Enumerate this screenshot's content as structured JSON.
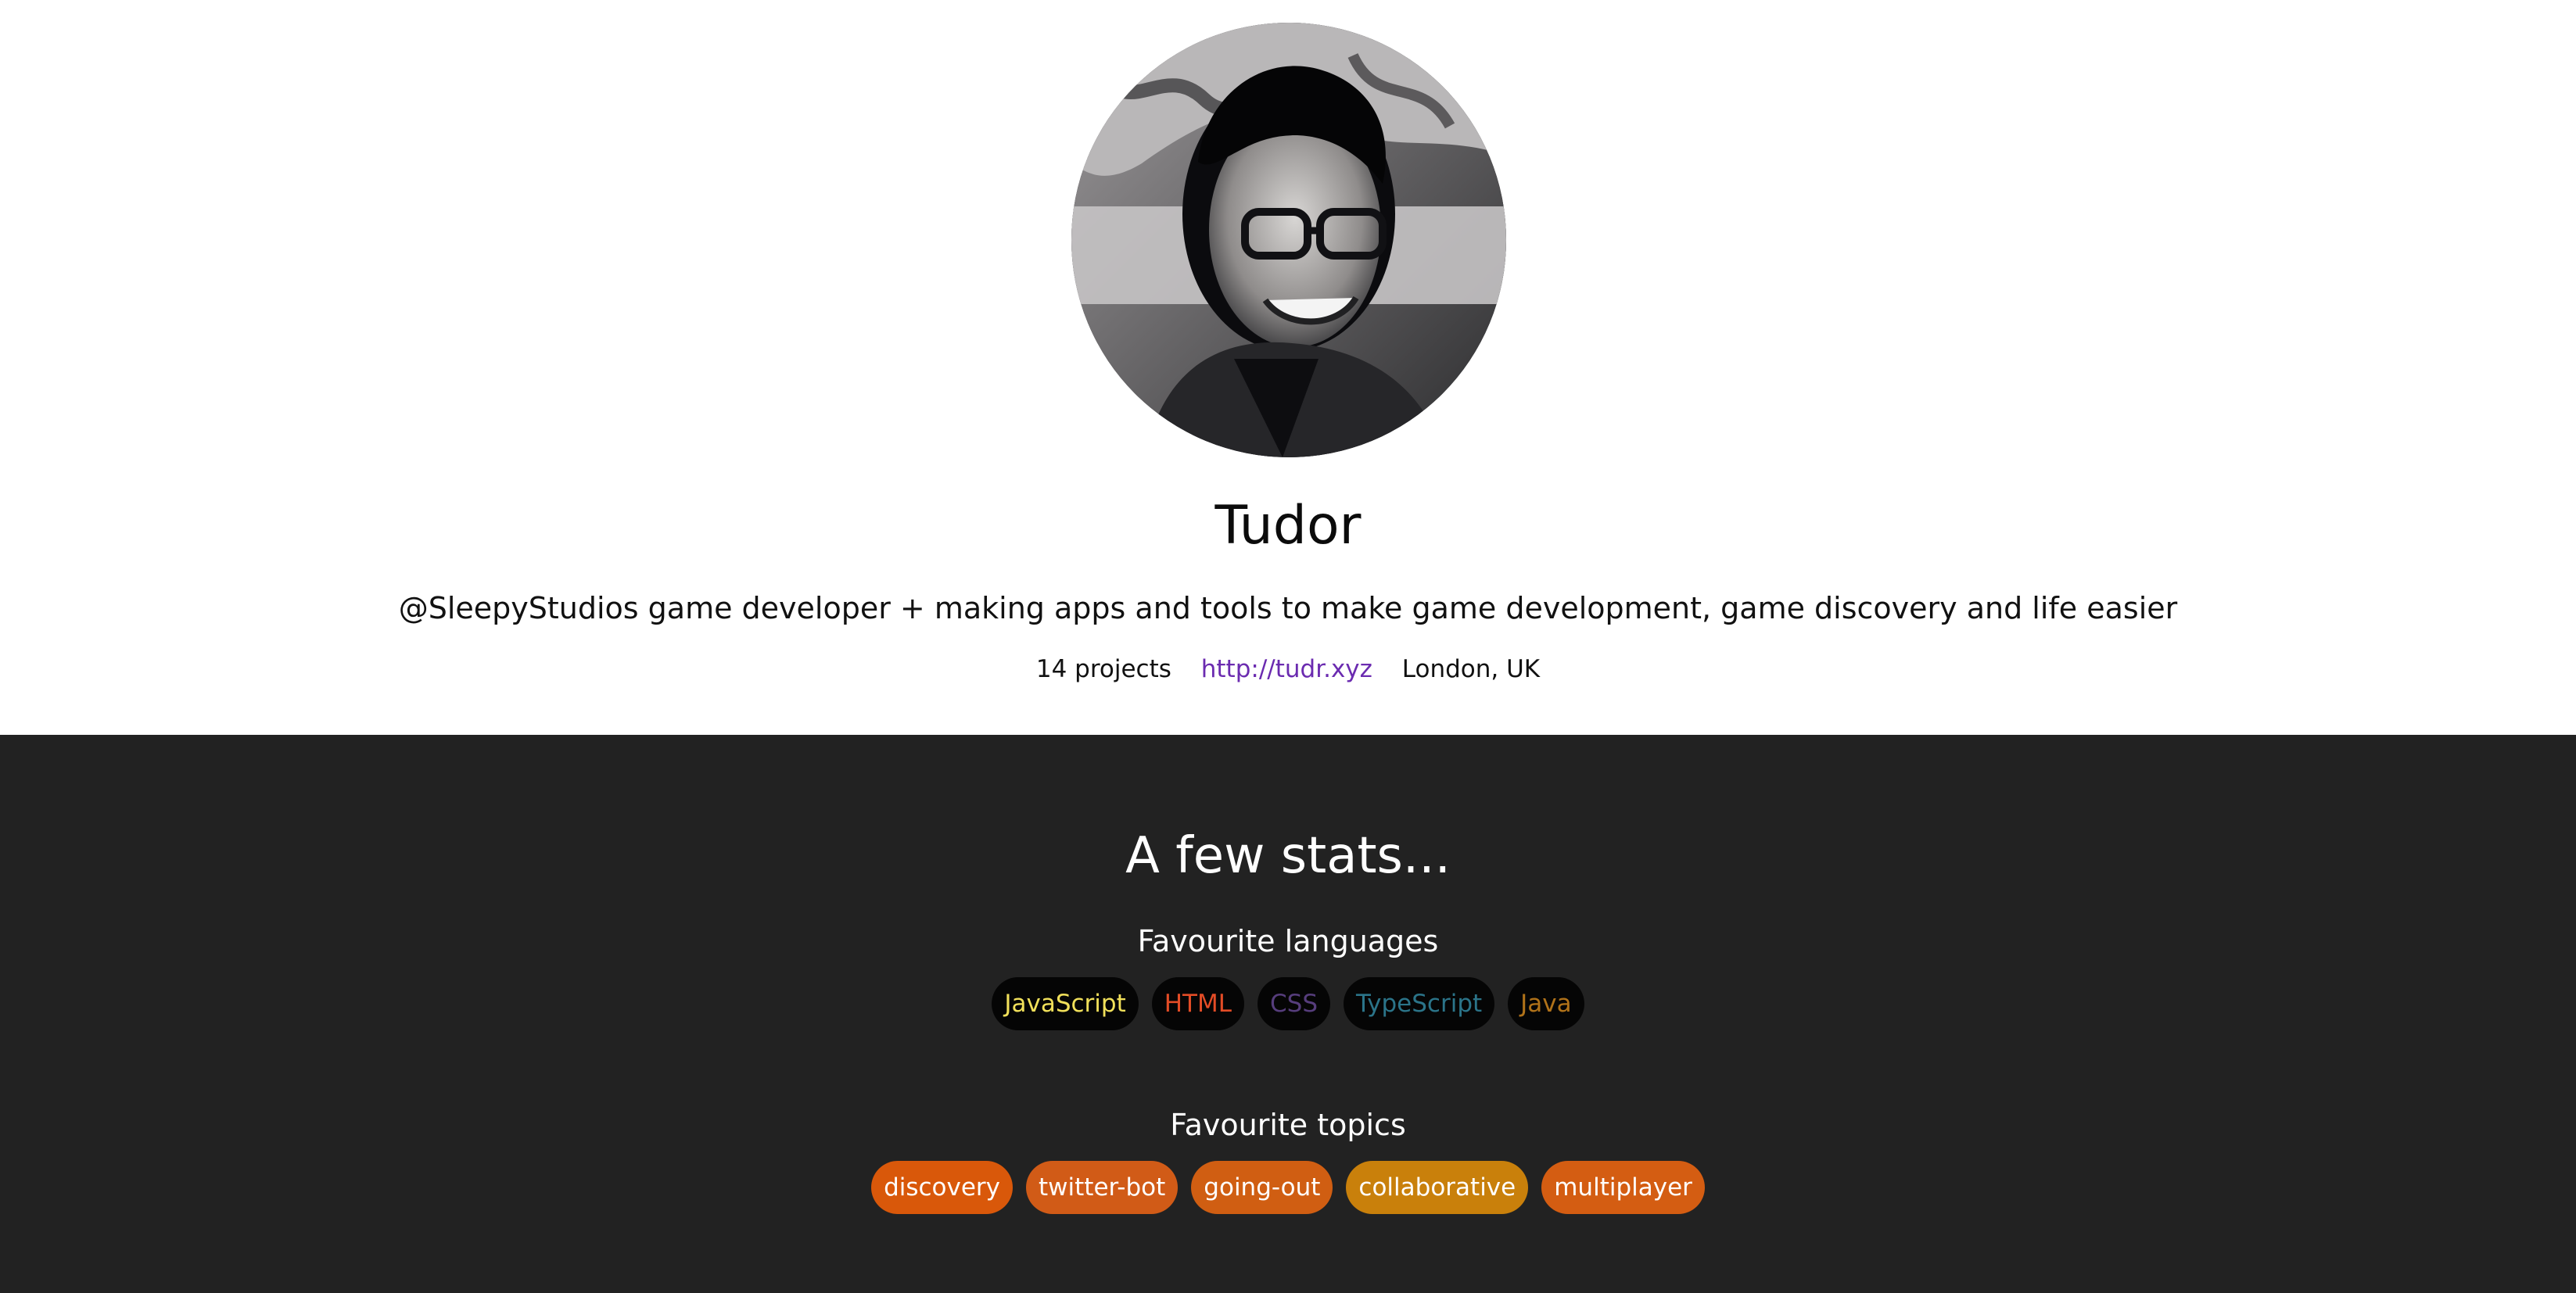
{
  "profile": {
    "name": "Tudor",
    "bio": "@SleepyStudios game developer + making apps and tools to make game development, game discovery and life easier",
    "projects": "14 projects",
    "website": "http://tudr.xyz",
    "location": "London, UK"
  },
  "stats": {
    "title": "A few stats...",
    "languages_title": "Favourite languages",
    "languages": [
      {
        "label": "JavaScript",
        "color": "#f1e05a"
      },
      {
        "label": "HTML",
        "color": "#e34c26"
      },
      {
        "label": "CSS",
        "color": "#563d7c"
      },
      {
        "label": "TypeScript",
        "color": "#2b7489"
      },
      {
        "label": "Java",
        "color": "#b07219"
      }
    ],
    "topics_title": "Favourite topics",
    "topics": [
      {
        "label": "discovery",
        "color": "#d9580a"
      },
      {
        "label": "twitter-bot",
        "color": "#d15b17"
      },
      {
        "label": "going-out",
        "color": "#d05e12"
      },
      {
        "label": "collaborative",
        "color": "#c9800b"
      },
      {
        "label": "multiplayer",
        "color": "#d45d12"
      }
    ]
  },
  "colors": {
    "dark_background": "#222222",
    "link": "#6b2bb0"
  }
}
